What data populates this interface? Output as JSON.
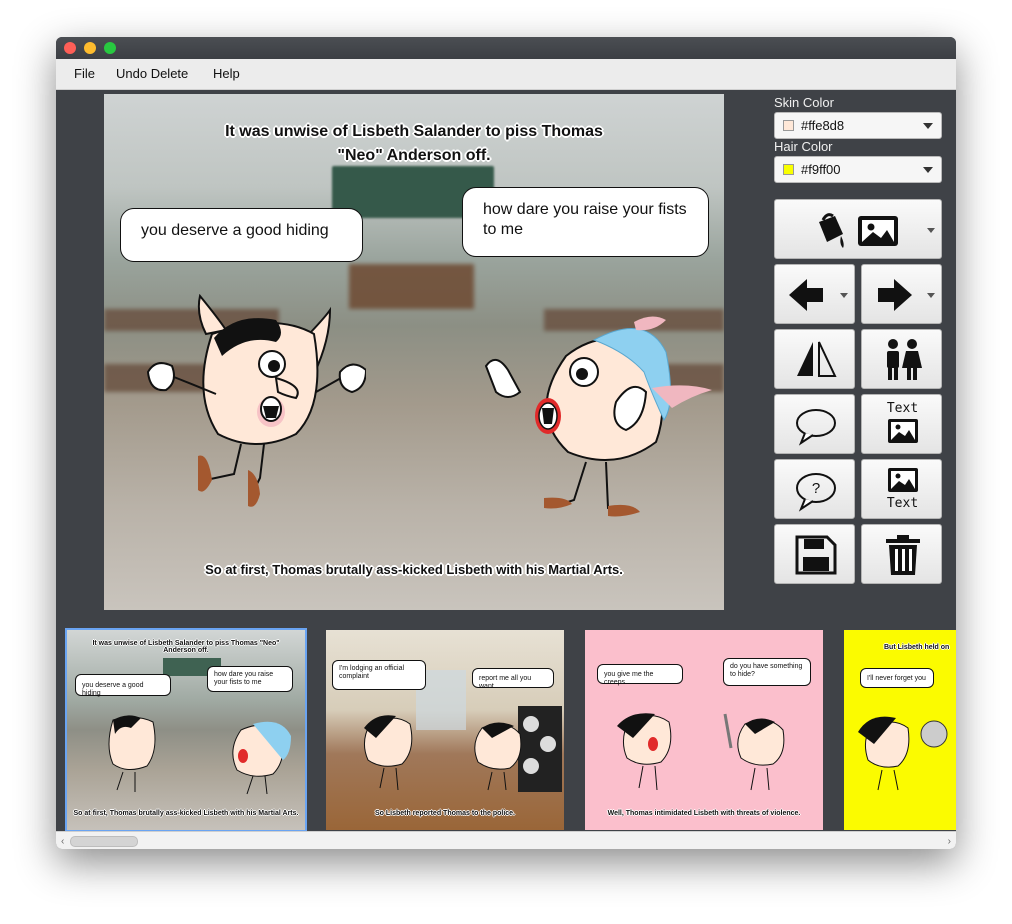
{
  "menu": {
    "file": "File",
    "undo_delete": "Undo Delete",
    "help": "Help"
  },
  "main_panel": {
    "top_caption": "It was unwise of Lisbeth Salander to piss Thomas \"Neo\" Anderson off.",
    "bubble_left": "you deserve a good hiding",
    "bubble_right": "how dare you raise your fists to me",
    "bottom_caption": "So at first, Thomas brutally ass-kicked Lisbeth with his Martial Arts."
  },
  "sidebar": {
    "skin_label": "Skin Color",
    "skin_value": "#ffe8d8",
    "hair_label": "Hair Color",
    "hair_value": "#f9ff00",
    "text_image_label": "Text",
    "image_text_label": "Text"
  },
  "thumbnails": [
    {
      "top": "It was unwise of Lisbeth Salander to piss Thomas \"Neo\" Anderson off.",
      "b1": "you deserve a good hiding",
      "b2": "how dare you raise your fists to me",
      "bottom": "So at first, Thomas brutally ass-kicked Lisbeth with his Martial Arts."
    },
    {
      "b1": "I'm lodging an official complaint",
      "b2": "report me all you want",
      "bottom": "So Lisbeth reported Thomas to the police."
    },
    {
      "b1": "you give me the creeps",
      "b2": "do you have something to hide?",
      "bottom": "Well, Thomas intimidated Lisbeth with threats of violence."
    },
    {
      "top": "But Lisbeth held on",
      "b1": "I'll never forget you"
    }
  ],
  "colors": {
    "skin": "#ffe8d8",
    "hair": "#f9ff00",
    "selection": "#6aa4f2"
  }
}
